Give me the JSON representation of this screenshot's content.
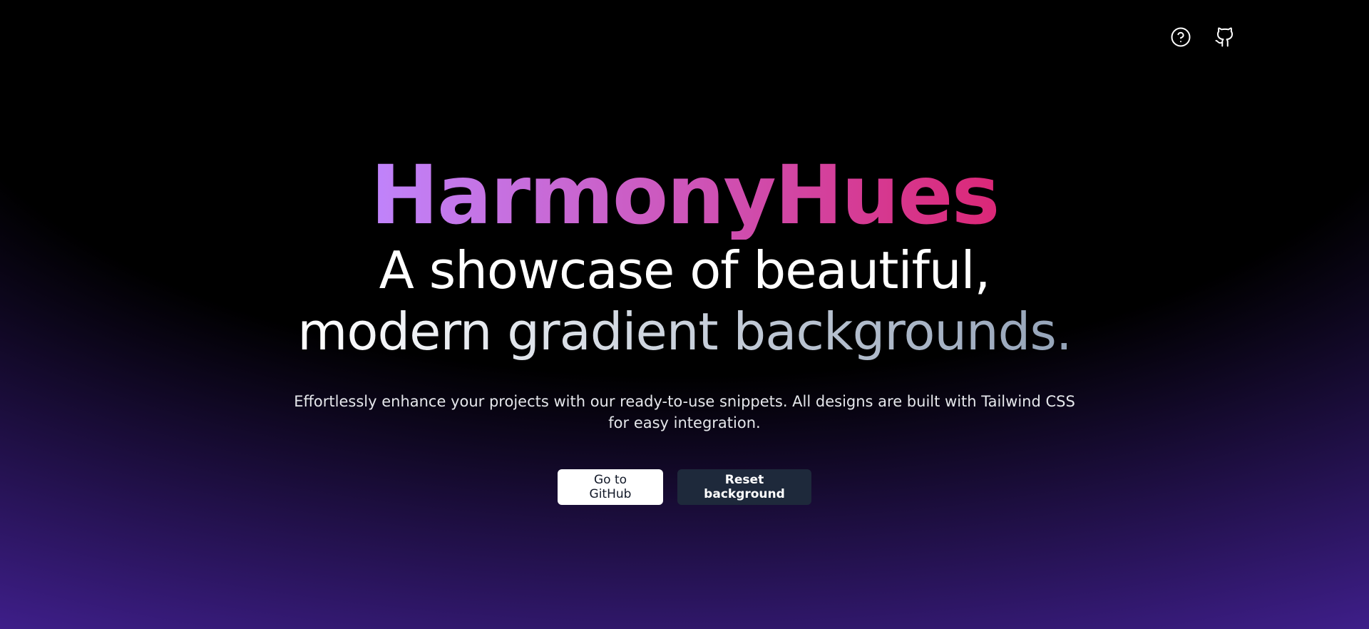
{
  "header": {
    "icons": [
      "help-circle-icon",
      "github-icon"
    ]
  },
  "hero": {
    "title": "HarmonyHues",
    "tagline_line1": "A showcase of beautiful,",
    "tagline_line2": "modern gradient backgrounds.",
    "description": "Effortlessly enhance your projects with our ready-to-use snippets. All designs are built with Tailwind CSS for easy integration."
  },
  "actions": {
    "github_label": "Go to GitHub",
    "reset_label": "Reset background"
  },
  "colors": {
    "background_top": "#000000",
    "background_bottom": "#5530b8",
    "title_gradient_start": "#c084fc",
    "title_gradient_end": "#db2777",
    "dark_button": "#1e293b"
  }
}
